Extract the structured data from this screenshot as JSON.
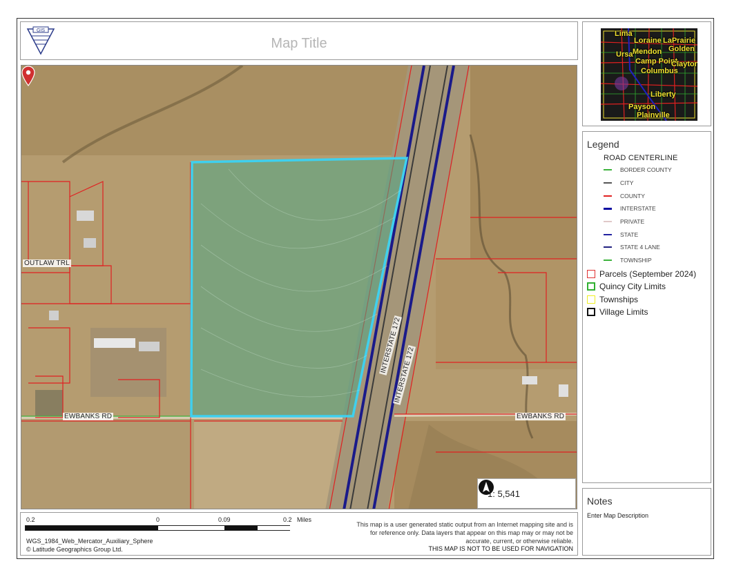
{
  "header": {
    "title": "Map Title",
    "logo_text": "GIS"
  },
  "map": {
    "road_labels": {
      "outlaw": "OUTLAW TRL",
      "ewbanks_left": "EWBANKS RD",
      "ewbanks_right": "EWBANKS RD",
      "interstate_1": "INTERSTATE 172",
      "interstate_2": "INTERSTATE 172"
    },
    "scale_ratio": "1: 5,541",
    "north_icon": "north-arrow-icon"
  },
  "overview": {
    "labels": [
      "Lima",
      "Loraine",
      "LaPrairie",
      "Ursa",
      "Mendon",
      "Golden",
      "Camp Point",
      "Clayton",
      "Columbus",
      "Liberty",
      "Payson",
      "Plainville"
    ]
  },
  "legend": {
    "title": "Legend",
    "road_header": "ROAD CENTERLINE",
    "road_items": [
      {
        "label": "BORDER COUNTY",
        "color": "#3cb33c"
      },
      {
        "label": "CITY",
        "color": "#555555"
      },
      {
        "label": "COUNTY",
        "color": "#e02020"
      },
      {
        "label": "INTERSTATE",
        "color": "#0a0aa0"
      },
      {
        "label": "PRIVATE",
        "color": "#e0c8c8"
      },
      {
        "label": "STATE",
        "color": "#2020a0"
      },
      {
        "label": "STATE 4 LANE",
        "color": "#202080"
      },
      {
        "label": "TOWNSHIP",
        "color": "#3cb33c"
      }
    ],
    "area_items": [
      {
        "label": "Parcels (September 2024)",
        "color": "#e03030",
        "style": "solid"
      },
      {
        "label": "Quincy City Limits",
        "color": "#30b030",
        "style": "dashed"
      },
      {
        "label": "Townships",
        "color": "#f0f020",
        "style": "solid"
      },
      {
        "label": "Village Limits",
        "color": "#111111",
        "style": "solid"
      }
    ]
  },
  "notes": {
    "title": "Notes",
    "description": "Enter Map Description"
  },
  "footer": {
    "scalebar": {
      "left": "0.2",
      "zero": "0",
      "mid": "0.09",
      "right": "0.2",
      "unit": "Miles"
    },
    "projection": "WGS_1984_Web_Mercator_Auxiliary_Sphere",
    "copyright": "© Latitude Geographics Group Ltd.",
    "disclaimer": "This map is a user generated static output from an Internet mapping site and is for reference only. Data layers that appear on this map may or may not be accurate, current, or otherwise reliable.",
    "warning": "THIS MAP IS NOT TO BE USED FOR NAVIGATION"
  }
}
